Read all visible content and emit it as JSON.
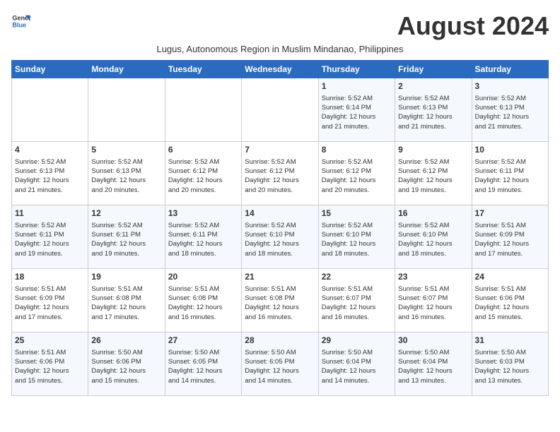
{
  "logo": {
    "line1": "General",
    "line2": "Blue"
  },
  "title": "August 2024",
  "subtitle": "Lugus, Autonomous Region in Muslim Mindanao, Philippines",
  "headers": [
    "Sunday",
    "Monday",
    "Tuesday",
    "Wednesday",
    "Thursday",
    "Friday",
    "Saturday"
  ],
  "weeks": [
    [
      {
        "day": "",
        "info": ""
      },
      {
        "day": "",
        "info": ""
      },
      {
        "day": "",
        "info": ""
      },
      {
        "day": "",
        "info": ""
      },
      {
        "day": "1",
        "info": "Sunrise: 5:52 AM\nSunset: 6:14 PM\nDaylight: 12 hours\nand 21 minutes."
      },
      {
        "day": "2",
        "info": "Sunrise: 5:52 AM\nSunset: 6:13 PM\nDaylight: 12 hours\nand 21 minutes."
      },
      {
        "day": "3",
        "info": "Sunrise: 5:52 AM\nSunset: 6:13 PM\nDaylight: 12 hours\nand 21 minutes."
      }
    ],
    [
      {
        "day": "4",
        "info": "Sunrise: 5:52 AM\nSunset: 6:13 PM\nDaylight: 12 hours\nand 21 minutes."
      },
      {
        "day": "5",
        "info": "Sunrise: 5:52 AM\nSunset: 6:13 PM\nDaylight: 12 hours\nand 20 minutes."
      },
      {
        "day": "6",
        "info": "Sunrise: 5:52 AM\nSunset: 6:12 PM\nDaylight: 12 hours\nand 20 minutes."
      },
      {
        "day": "7",
        "info": "Sunrise: 5:52 AM\nSunset: 6:12 PM\nDaylight: 12 hours\nand 20 minutes."
      },
      {
        "day": "8",
        "info": "Sunrise: 5:52 AM\nSunset: 6:12 PM\nDaylight: 12 hours\nand 20 minutes."
      },
      {
        "day": "9",
        "info": "Sunrise: 5:52 AM\nSunset: 6:12 PM\nDaylight: 12 hours\nand 19 minutes."
      },
      {
        "day": "10",
        "info": "Sunrise: 5:52 AM\nSunset: 6:11 PM\nDaylight: 12 hours\nand 19 minutes."
      }
    ],
    [
      {
        "day": "11",
        "info": "Sunrise: 5:52 AM\nSunset: 6:11 PM\nDaylight: 12 hours\nand 19 minutes."
      },
      {
        "day": "12",
        "info": "Sunrise: 5:52 AM\nSunset: 6:11 PM\nDaylight: 12 hours\nand 19 minutes."
      },
      {
        "day": "13",
        "info": "Sunrise: 5:52 AM\nSunset: 6:11 PM\nDaylight: 12 hours\nand 18 minutes."
      },
      {
        "day": "14",
        "info": "Sunrise: 5:52 AM\nSunset: 6:10 PM\nDaylight: 12 hours\nand 18 minutes."
      },
      {
        "day": "15",
        "info": "Sunrise: 5:52 AM\nSunset: 6:10 PM\nDaylight: 12 hours\nand 18 minutes."
      },
      {
        "day": "16",
        "info": "Sunrise: 5:52 AM\nSunset: 6:10 PM\nDaylight: 12 hours\nand 18 minutes."
      },
      {
        "day": "17",
        "info": "Sunrise: 5:51 AM\nSunset: 6:09 PM\nDaylight: 12 hours\nand 17 minutes."
      }
    ],
    [
      {
        "day": "18",
        "info": "Sunrise: 5:51 AM\nSunset: 6:09 PM\nDaylight: 12 hours\nand 17 minutes."
      },
      {
        "day": "19",
        "info": "Sunrise: 5:51 AM\nSunset: 6:08 PM\nDaylight: 12 hours\nand 17 minutes."
      },
      {
        "day": "20",
        "info": "Sunrise: 5:51 AM\nSunset: 6:08 PM\nDaylight: 12 hours\nand 16 minutes."
      },
      {
        "day": "21",
        "info": "Sunrise: 5:51 AM\nSunset: 6:08 PM\nDaylight: 12 hours\nand 16 minutes."
      },
      {
        "day": "22",
        "info": "Sunrise: 5:51 AM\nSunset: 6:07 PM\nDaylight: 12 hours\nand 16 minutes."
      },
      {
        "day": "23",
        "info": "Sunrise: 5:51 AM\nSunset: 6:07 PM\nDaylight: 12 hours\nand 16 minutes."
      },
      {
        "day": "24",
        "info": "Sunrise: 5:51 AM\nSunset: 6:06 PM\nDaylight: 12 hours\nand 15 minutes."
      }
    ],
    [
      {
        "day": "25",
        "info": "Sunrise: 5:51 AM\nSunset: 6:06 PM\nDaylight: 12 hours\nand 15 minutes."
      },
      {
        "day": "26",
        "info": "Sunrise: 5:50 AM\nSunset: 6:06 PM\nDaylight: 12 hours\nand 15 minutes."
      },
      {
        "day": "27",
        "info": "Sunrise: 5:50 AM\nSunset: 6:05 PM\nDaylight: 12 hours\nand 14 minutes."
      },
      {
        "day": "28",
        "info": "Sunrise: 5:50 AM\nSunset: 6:05 PM\nDaylight: 12 hours\nand 14 minutes."
      },
      {
        "day": "29",
        "info": "Sunrise: 5:50 AM\nSunset: 6:04 PM\nDaylight: 12 hours\nand 14 minutes."
      },
      {
        "day": "30",
        "info": "Sunrise: 5:50 AM\nSunset: 6:04 PM\nDaylight: 12 hours\nand 13 minutes."
      },
      {
        "day": "31",
        "info": "Sunrise: 5:50 AM\nSunset: 6:03 PM\nDaylight: 12 hours\nand 13 minutes."
      }
    ]
  ]
}
